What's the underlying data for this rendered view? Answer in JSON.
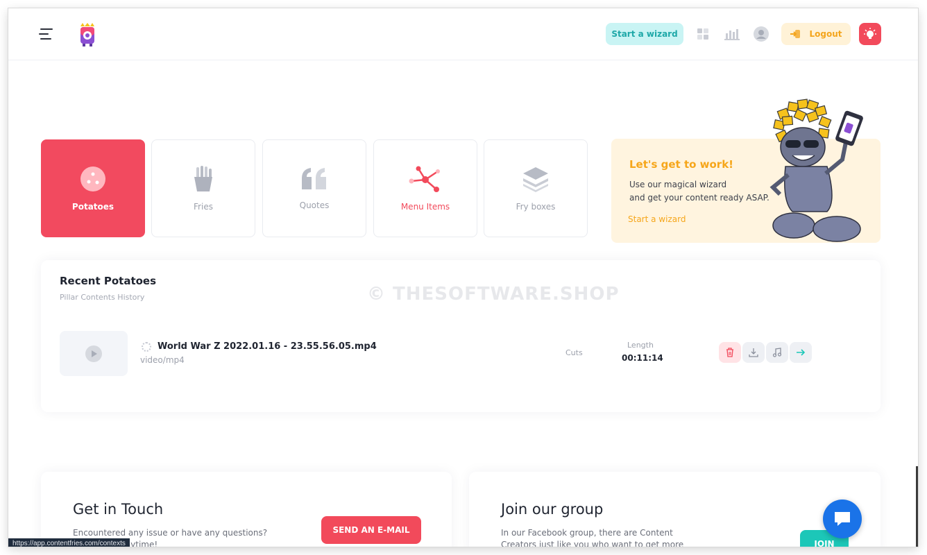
{
  "header": {
    "start_wizard_label": "Start a wizard",
    "logout_label": "Logout"
  },
  "tiles": [
    {
      "label": "Potatoes",
      "icon": "potato-icon",
      "active": true
    },
    {
      "label": "Fries",
      "icon": "fries-icon"
    },
    {
      "label": "Quotes",
      "icon": "quote-icon"
    },
    {
      "label": "Menu Items",
      "icon": "share-nodes-icon"
    },
    {
      "label": "Fry boxes",
      "icon": "layers-icon"
    }
  ],
  "promo": {
    "title": "Let's get to work!",
    "text_line1": "Use our magical wizard",
    "text_line2": "and get your content ready ASAP.",
    "link": "Start a wizard"
  },
  "recent": {
    "title": "Recent Potatoes",
    "subtitle": "Pillar Contents History",
    "watermark": "© THESOFTWARE.SHOP",
    "item": {
      "file_name": "World War Z 2022.01.16 - 23.55.56.05.mp4",
      "file_type": "video/mp4",
      "cuts_label": "Cuts",
      "length_label": "Length",
      "length_value": "00:11:14"
    }
  },
  "contact": {
    "title": "Get in Touch",
    "text": "Encountered any issue or have any questions? Contact us anytime!",
    "button": "SEND AN E-MAIL"
  },
  "group": {
    "title": "Join our group",
    "text": "In our Facebook group, there are Content Creators just like you who want to get more",
    "button": "JOIN"
  },
  "status_bar_url": "https://app.contentfries.com/contexts",
  "colors": {
    "primary_red": "#f24a5f",
    "teal": "#1ea8a8",
    "orange": "#f6a61a",
    "chat_blue": "#1a73e8"
  }
}
